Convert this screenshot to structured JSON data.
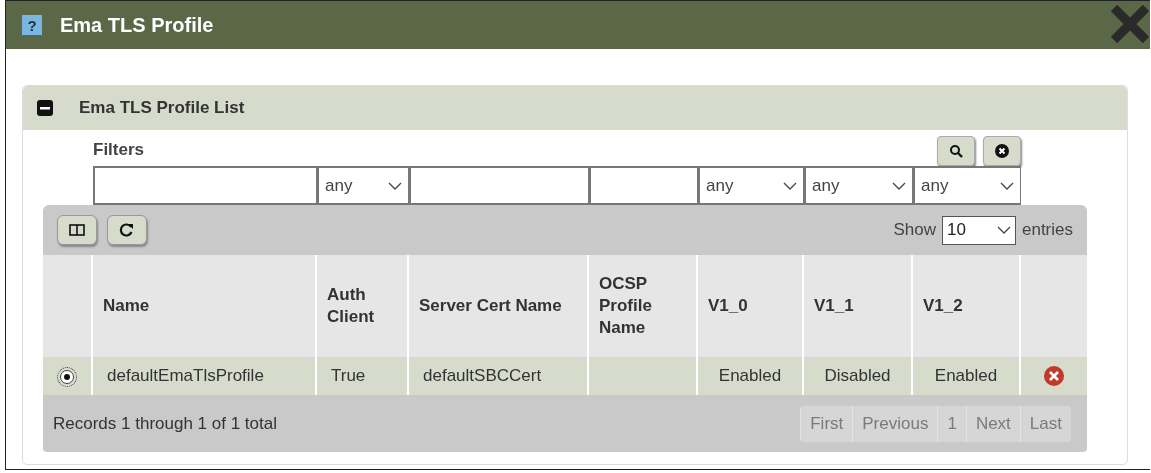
{
  "window": {
    "help_icon": "?",
    "title": "Ema TLS Profile"
  },
  "panel": {
    "title": "Ema TLS Profile List",
    "expanded": true
  },
  "filters": {
    "label": "Filters",
    "fields": [
      {
        "kind": "text"
      },
      {
        "kind": "select",
        "value": "any"
      },
      {
        "kind": "text"
      },
      {
        "kind": "text"
      },
      {
        "kind": "select",
        "value": "any"
      },
      {
        "kind": "select",
        "value": "any"
      },
      {
        "kind": "select",
        "value": "any"
      }
    ]
  },
  "toolbar": {
    "show_label": "Show",
    "page_size": "10",
    "entries_label": "entries"
  },
  "table": {
    "columns": [
      "Name",
      "Auth Client",
      "Server Cert Name",
      "OCSP Profile Name",
      "V1_0",
      "V1_1",
      "V1_2"
    ],
    "rows": [
      {
        "selected": true,
        "cells": [
          "defaultEmaTlsProfile",
          "True",
          "defaultSBCCert",
          "",
          "Enabled",
          "Disabled",
          "Enabled"
        ]
      }
    ]
  },
  "footer": {
    "records": "Records 1 through 1 of 1 total",
    "pages": [
      {
        "label": "First",
        "disabled": true
      },
      {
        "label": "Previous",
        "disabled": true
      },
      {
        "label": "1",
        "disabled": true
      },
      {
        "label": "Next",
        "disabled": true
      },
      {
        "label": "Last",
        "disabled": true
      }
    ]
  }
}
